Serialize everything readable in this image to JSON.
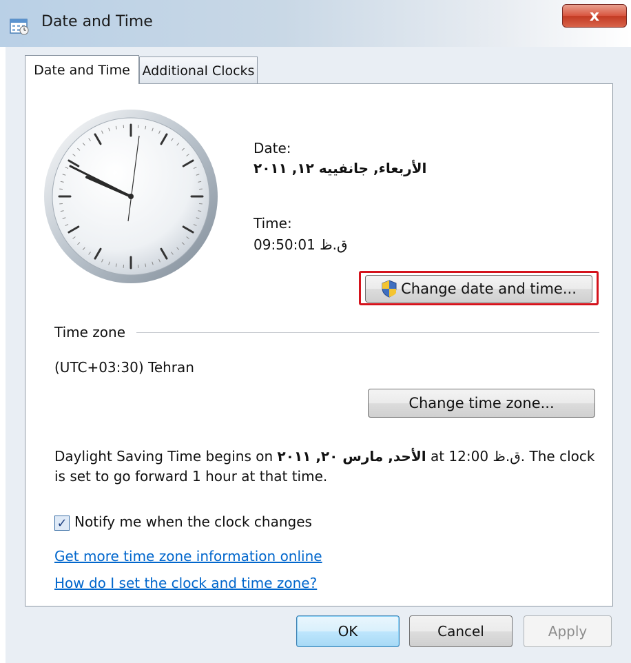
{
  "window": {
    "title": "Date and Time",
    "close_label": "x"
  },
  "tabs": [
    {
      "label": "Date and Time",
      "active": true
    },
    {
      "label": "Additional Clocks",
      "active": false
    }
  ],
  "datetime": {
    "date_label": "Date:",
    "date_value": "الأربعاء, جانفييه ١٢, ٢٠١١",
    "time_label": "Time:",
    "time_value": "ق.ظ 09:50:01",
    "change_button": "Change date and time..."
  },
  "timezone": {
    "heading": "Time zone",
    "value": "(UTC+03:30) Tehran",
    "change_button": "Change time zone..."
  },
  "dst": {
    "line1_prefix": "Daylight Saving Time begins on",
    "line1_date": "الأحد, مارس ٢٠, ٢٠١١",
    "line1_at": "at",
    "line1_time": "ق.ظ 12:00",
    "line1_suffix": ". The clock",
    "line2": "is set to go forward 1 hour at that time."
  },
  "notify": {
    "label": "Notify me when the clock changes",
    "checked": true
  },
  "links": {
    "more_info": "Get more time zone information online",
    "how_to": "How do I set the clock and time zone?"
  },
  "buttons": {
    "ok": "OK",
    "cancel": "Cancel",
    "apply": "Apply"
  },
  "colors": {
    "highlight": "#d4131c",
    "link": "#0066cc",
    "close_button": "#c23a23"
  },
  "icons": {
    "title": "date-time-window-icon",
    "shield": "uac-shield-icon",
    "check": "checkmark-icon"
  }
}
